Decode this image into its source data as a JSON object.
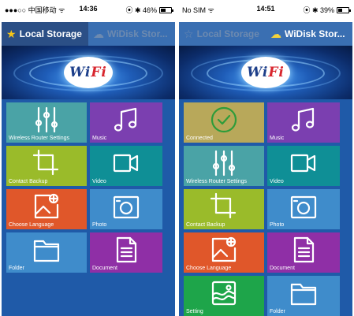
{
  "left": {
    "status": {
      "carrier": "●●●○○ 中国移动 ᯤ",
      "time": "14:36",
      "battery_text": "⦿ ✱ 46%",
      "battery_level": 0.46
    },
    "tabs": [
      {
        "label": "Local Storage",
        "icon": "star-icon"
      },
      {
        "label": "WiDisk Stor...",
        "icon": "cloud-icon"
      }
    ],
    "logo": {
      "main": "Wi",
      "accent": "Fi",
      "small": "UA"
    },
    "tiles": [
      {
        "label": "Wireless Router Settings",
        "icon": "sliders-icon",
        "color": "#4aa3a6"
      },
      {
        "label": "Music",
        "icon": "music-icon",
        "color": "#7b3fb0"
      },
      {
        "label": "Contact Backup",
        "icon": "crop-icon",
        "color": "#9abb2a"
      },
      {
        "label": "Video",
        "icon": "video-icon",
        "color": "#0f8f96"
      },
      {
        "label": "Choose Language",
        "icon": "image-add-icon",
        "color": "#e0572a"
      },
      {
        "label": "Photo",
        "icon": "camera-icon",
        "color": "#3f8ccb"
      },
      {
        "label": "Folder",
        "icon": "folder-icon",
        "color": "#3f8ccb"
      },
      {
        "label": "Document",
        "icon": "document-icon",
        "color": "#8f2fa6"
      }
    ]
  },
  "right": {
    "status": {
      "carrier": "No SIM ᯤ",
      "time": "14:51",
      "battery_text": "⦿ ✱ 39%",
      "battery_level": 0.39
    },
    "tabs": [
      {
        "label": "Local Storage",
        "icon": "star-outline-icon"
      },
      {
        "label": "WiDisk Stor...",
        "icon": "cloud-icon"
      }
    ],
    "logo": {
      "main": "Wi",
      "accent": "Fi",
      "small": "UA"
    },
    "tiles": [
      {
        "label": "Connected",
        "icon": "check-circle-icon",
        "color": "#b8a85a"
      },
      {
        "label": "Music",
        "icon": "music-icon",
        "color": "#7b3fb0"
      },
      {
        "label": "Wireless Router Settings",
        "icon": "sliders-icon",
        "color": "#4aa3a6"
      },
      {
        "label": "Video",
        "icon": "video-icon",
        "color": "#0f8f96"
      },
      {
        "label": "Contact Backup",
        "icon": "crop-icon",
        "color": "#9abb2a"
      },
      {
        "label": "Photo",
        "icon": "camera-icon",
        "color": "#3f8ccb"
      },
      {
        "label": "Choose Language",
        "icon": "image-add-icon",
        "color": "#e0572a"
      },
      {
        "label": "Document",
        "icon": "document-icon",
        "color": "#8f2fa6"
      },
      {
        "label": "Setting",
        "icon": "landscape-icon",
        "color": "#1ea54a"
      },
      {
        "label": "Folder",
        "icon": "folder-icon",
        "color": "#3f8ccb"
      }
    ]
  }
}
